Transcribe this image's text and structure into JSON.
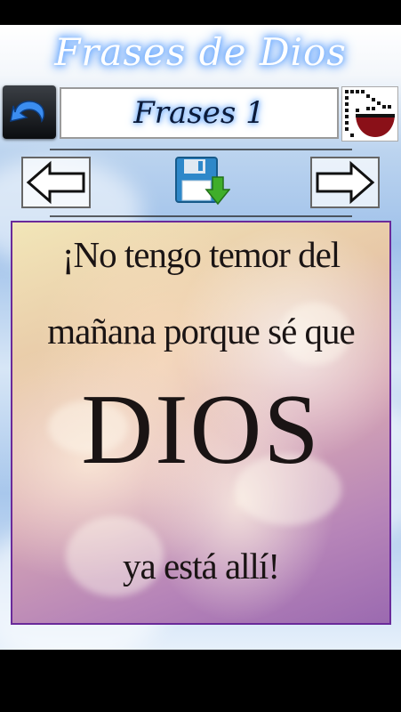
{
  "app": {
    "title": "Frases de Dios"
  },
  "header": {
    "phrase_label": "Frases 1"
  },
  "quote": {
    "line1": "¡No tengo temor del",
    "line2": "mañana porque sé que",
    "line3": "DIOS",
    "line4": "ya está allí!"
  },
  "icons": {
    "back": "undo-arrow-icon",
    "bible": "bible-icon",
    "prev": "left-arrow-icon",
    "save": "save-download-icon",
    "next": "right-arrow-icon"
  },
  "colors": {
    "title_glow": "#6aa9ff",
    "back_arrow": "#3b8df0",
    "save_disk": "#2e88c9",
    "download_arrow": "#3fae2a",
    "image_border": "#6a2a9a"
  }
}
